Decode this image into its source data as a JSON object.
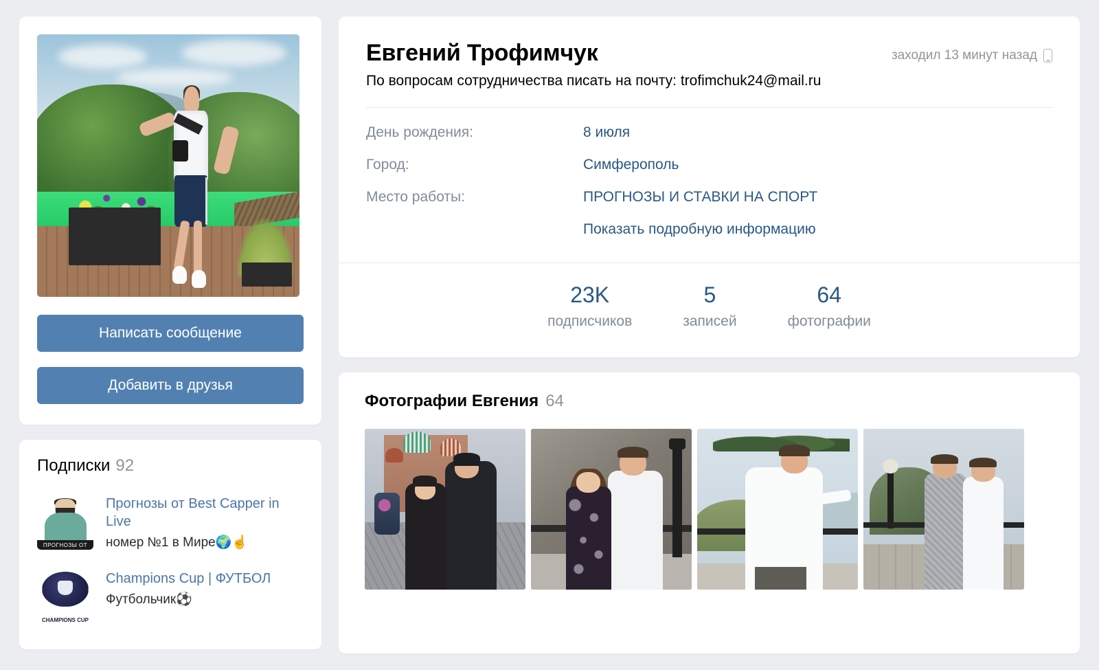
{
  "profile": {
    "name": "Евгений Трофимчук",
    "last_seen": "заходил 13 минут назад",
    "last_seen_device_icon": "mobile-phone-icon",
    "bio": "По вопросам сотрудничества писать на почту: trofimchuk24@mail.ru",
    "avatar_alt": "Мужчина на деревянной террасе на фоне зелёных гор",
    "actions": {
      "message": "Написать сообщение",
      "add_friend": "Добавить в друзья"
    },
    "details": [
      {
        "label": "День рождения:",
        "value": "8 июля"
      },
      {
        "label": "Город:",
        "value": "Симферополь"
      },
      {
        "label": "Место работы:",
        "value": "ПРОГНОЗЫ И СТАВКИ НА СПОРТ"
      }
    ],
    "show_more": "Показать подробную информацию",
    "counters": [
      {
        "value": "23K",
        "label": "подписчиков"
      },
      {
        "value": "5",
        "label": "записей"
      },
      {
        "value": "64",
        "label": "фотографии"
      }
    ]
  },
  "subscriptions": {
    "title": "Подписки",
    "count": "92",
    "items": [
      {
        "title": "Прогнозы от Best Capper in Live",
        "subtitle": "номер №1 в Мире🌍☝",
        "avatar_alt": "Бородатый мужчина в бирюзовой куртке",
        "avatar_band": "ПРОГНОЗЫ ОТ"
      },
      {
        "title": "Champions Cup | ФУТБОЛ",
        "subtitle": "Футбольчик⚽",
        "avatar_alt": "Тёмно-синий логотип кубка",
        "avatar_band": "CHAMPIONS CUP"
      }
    ]
  },
  "photos": {
    "title": "Фотографии Евгения",
    "count": "64",
    "items": [
      {
        "alt": "Пара в зимней одежде на Красной площади"
      },
      {
        "alt": "Пара у ограждения: девушка в тёмном платье, мужчина в белой рубашке"
      },
      {
        "alt": "Мужчина в белой рубашке у ограждения на фоне гор и моря"
      },
      {
        "alt": "Двое мужчин у каменного парапета на фоне горы"
      }
    ]
  },
  "theme": {
    "page_background": "#ebedf0",
    "card_background": "#ffffff",
    "accent_button": "#5281b1",
    "link_color": "#2a5885",
    "muted_text": "#818c99"
  }
}
